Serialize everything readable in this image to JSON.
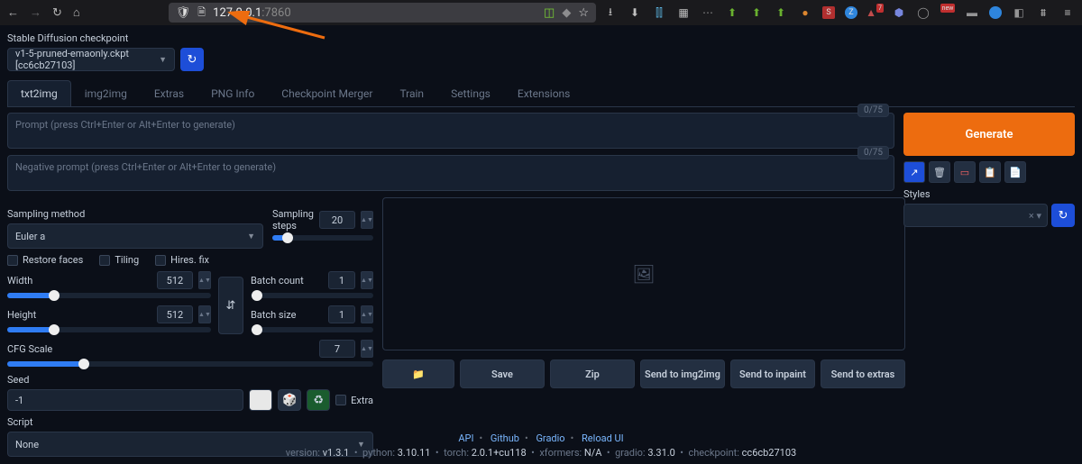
{
  "browser": {
    "url_ip": "127.0.0.1",
    "url_port": ":7860"
  },
  "checkpoint": {
    "label": "Stable Diffusion checkpoint",
    "value": "v1-5-pruned-emaonly.ckpt [cc6cb27103]"
  },
  "tabs": [
    "txt2img",
    "img2img",
    "Extras",
    "PNG Info",
    "Checkpoint Merger",
    "Train",
    "Settings",
    "Extensions"
  ],
  "prompt": {
    "placeholder": "Prompt (press Ctrl+Enter or Alt+Enter to generate)",
    "token": "0/75"
  },
  "neg_prompt": {
    "placeholder": "Negative prompt (press Ctrl+Enter or Alt+Enter to generate)",
    "token": "0/75"
  },
  "sampling": {
    "method_label": "Sampling method",
    "method_value": "Euler a",
    "steps_label": "Sampling steps",
    "steps_value": "20"
  },
  "checks": {
    "restore": "Restore faces",
    "tiling": "Tiling",
    "hires": "Hires. fix"
  },
  "dims": {
    "width_label": "Width",
    "width_value": "512",
    "height_label": "Height",
    "height_value": "512"
  },
  "batch": {
    "count_label": "Batch count",
    "count_value": "1",
    "size_label": "Batch size",
    "size_value": "1"
  },
  "cfg": {
    "label": "CFG Scale",
    "value": "7"
  },
  "seed": {
    "label": "Seed",
    "value": "-1",
    "extra": "Extra"
  },
  "script": {
    "label": "Script",
    "value": "None"
  },
  "generate": "Generate",
  "styles": {
    "label": "Styles",
    "clear": "× ▾"
  },
  "outbtns": {
    "folder": "📁",
    "save": "Save",
    "zip": "Zip",
    "img2img": "Send to img2img",
    "inpaint": "Send to inpaint",
    "extras": "Send to extras"
  },
  "footer": {
    "links": [
      "API",
      "Github",
      "Gradio",
      "Reload UI"
    ],
    "version_label": "version: ",
    "version": "v1.3.1",
    "python_label": "python: ",
    "python": "3.10.11",
    "torch_label": "torch: ",
    "torch": "2.0.1+cu118",
    "xformers_label": "xformers: ",
    "xformers": "N/A",
    "gradio_label": "gradio: ",
    "gradio": "3.31.0",
    "ckpt_label": "checkpoint: ",
    "ckpt": "cc6cb27103"
  }
}
